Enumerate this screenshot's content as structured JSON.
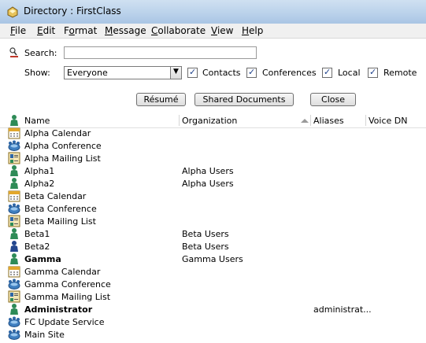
{
  "window": {
    "title": "Directory : FirstClass"
  },
  "menu": [
    {
      "label": "File",
      "mnemonic": "F",
      "rest": "ile"
    },
    {
      "label": "Edit",
      "mnemonic": "E",
      "rest": "dit"
    },
    {
      "label": "Format",
      "mnemonic": "",
      "pre": "F",
      "ul": "o",
      "post": "rmat"
    },
    {
      "label": "Message",
      "mnemonic": "M",
      "rest": "essage"
    },
    {
      "label": "Collaborate",
      "mnemonic": "C",
      "rest": "ollaborate"
    },
    {
      "label": "View",
      "mnemonic": "V",
      "rest": "iew"
    },
    {
      "label": "Help",
      "mnemonic": "H",
      "rest": "elp"
    }
  ],
  "search": {
    "label": "Search:",
    "value": ""
  },
  "show": {
    "label": "Show:",
    "selected": "Everyone",
    "filters": [
      {
        "label": "Contacts",
        "checked": true
      },
      {
        "label": "Conferences",
        "checked": true
      },
      {
        "label": "Local",
        "checked": true
      },
      {
        "label": "Remote",
        "checked": true
      }
    ]
  },
  "buttons": {
    "resume": "Résumé",
    "shared_documents": "Shared Documents",
    "close": "Close"
  },
  "columns": {
    "name": "Name",
    "organization": "Organization",
    "aliases": "Aliases",
    "voice_dn": "Voice DN"
  },
  "rows": [
    {
      "icon": "calendar-icon",
      "name": "Alpha Calendar",
      "org": "",
      "alias": "",
      "bold": false
    },
    {
      "icon": "conference-icon",
      "name": "Alpha Conference",
      "org": "",
      "alias": "",
      "bold": false
    },
    {
      "icon": "mailing-list-icon",
      "name": "Alpha Mailing List",
      "org": "",
      "alias": "",
      "bold": false
    },
    {
      "icon": "user-icon",
      "name": "Alpha1",
      "org": "Alpha Users",
      "alias": "",
      "bold": false
    },
    {
      "icon": "user-icon",
      "name": "Alpha2",
      "org": "Alpha Users",
      "alias": "",
      "bold": false
    },
    {
      "icon": "calendar-icon",
      "name": "Beta Calendar",
      "org": "",
      "alias": "",
      "bold": false
    },
    {
      "icon": "conference-icon",
      "name": "Beta Conference",
      "org": "",
      "alias": "",
      "bold": false
    },
    {
      "icon": "mailing-list-icon",
      "name": "Beta Mailing List",
      "org": "",
      "alias": "",
      "bold": false
    },
    {
      "icon": "user-icon",
      "name": "Beta1",
      "org": "Beta Users",
      "alias": "",
      "bold": false
    },
    {
      "icon": "user-blue-icon",
      "name": "Beta2",
      "org": "Beta Users",
      "alias": "",
      "bold": false
    },
    {
      "icon": "user-icon",
      "name": "Gamma",
      "org": "Gamma Users",
      "alias": "",
      "bold": true
    },
    {
      "icon": "calendar-icon",
      "name": "Gamma Calendar",
      "org": "",
      "alias": "",
      "bold": false
    },
    {
      "icon": "conference-icon",
      "name": "Gamma Conference",
      "org": "",
      "alias": "",
      "bold": false
    },
    {
      "icon": "mailing-list-icon",
      "name": "Gamma Mailing List",
      "org": "",
      "alias": "",
      "bold": false
    },
    {
      "icon": "user-icon",
      "name": "Administrator",
      "org": "",
      "alias": "administrat...",
      "bold": true
    },
    {
      "icon": "conference-icon",
      "name": "FC Update Service",
      "org": "",
      "alias": "",
      "bold": false
    },
    {
      "icon": "conference-icon",
      "name": "Main Site",
      "org": "",
      "alias": "",
      "bold": false
    }
  ]
}
